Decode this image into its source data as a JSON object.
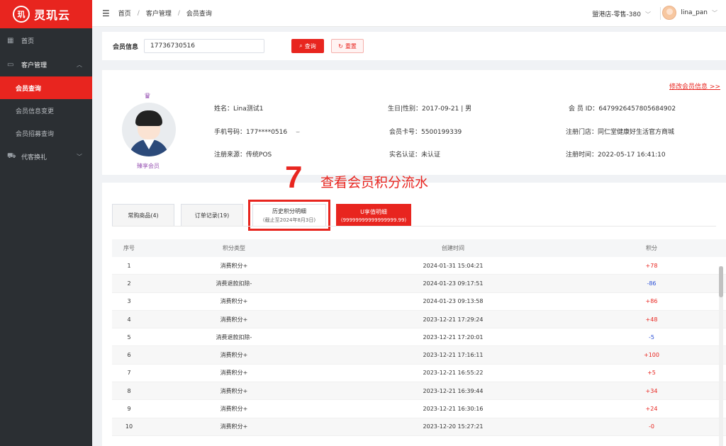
{
  "app": {
    "name": "灵玑云",
    "logo_mark": "玑"
  },
  "sidebar": {
    "items": [
      {
        "icon": "grid-icon",
        "label": "首页"
      },
      {
        "icon": "box-icon",
        "label": "客户管理",
        "expanded": true,
        "children": [
          {
            "label": "会员查询",
            "active": true
          },
          {
            "label": "会员信息变更"
          },
          {
            "label": "会员招募查询"
          }
        ]
      },
      {
        "icon": "cart-icon",
        "label": "代客换礼"
      }
    ]
  },
  "header": {
    "breadcrumb": [
      "首页",
      "客户管理",
      "会员查询"
    ],
    "store": "盟港店-零售-380",
    "username": "lina_pan"
  },
  "search": {
    "label": "会员信息",
    "value": "17736730516",
    "query_label": "查询",
    "reset_label": "重置"
  },
  "member": {
    "edit_link": "修改会员信息 >>",
    "level": "臻享会员",
    "name_label": "姓名：",
    "name": "Lina测试1",
    "birthday_label": "生日|性别：",
    "birthday": "2017-09-21 | 男",
    "id_label": "会 员 ID：",
    "id": "6479926457805684902",
    "phone_label": "手机号码：",
    "phone": "177****0516",
    "card_label": "会员卡号：",
    "card": "5500199339",
    "store_label": "注册门店：",
    "store": "同仁堂健康好生活官方商城",
    "source_label": "注册来源：",
    "source": "传统POS",
    "auth_label": "实名认证：",
    "auth": "未认证",
    "regtime_label": "注册时间：",
    "regtime": "2022-05-17 16:41:10"
  },
  "annotation": {
    "number": "7",
    "text": "查看会员积分流水"
  },
  "tabs": [
    {
      "label": "常购商品(4)",
      "sub": ""
    },
    {
      "label": "订单记录(19)",
      "sub": ""
    },
    {
      "label": "历史积分明细",
      "sub": "(截止至2024年8月3日)"
    },
    {
      "label": "U享值明细",
      "sub": "(99999999999999999.99)"
    }
  ],
  "table": {
    "headers": [
      "序号",
      "积分类型",
      "创建时间",
      "积分"
    ],
    "rows": [
      {
        "no": "1",
        "type": "消费积分+",
        "time": "2024-01-31 15:04:21",
        "points": "+78"
      },
      {
        "no": "2",
        "type": "消费退款扣除-",
        "time": "2024-01-23 09:17:51",
        "points": "-86"
      },
      {
        "no": "3",
        "type": "消费积分+",
        "time": "2024-01-23 09:13:58",
        "points": "+86"
      },
      {
        "no": "4",
        "type": "消费积分+",
        "time": "2023-12-21 17:29:24",
        "points": "+48"
      },
      {
        "no": "5",
        "type": "消费退款扣除-",
        "time": "2023-12-21 17:20:01",
        "points": "-5"
      },
      {
        "no": "6",
        "type": "消费积分+",
        "time": "2023-12-21 17:16:11",
        "points": "+100"
      },
      {
        "no": "7",
        "type": "消费积分+",
        "time": "2023-12-21 16:55:22",
        "points": "+5"
      },
      {
        "no": "8",
        "type": "消费积分+",
        "time": "2023-12-21 16:39:44",
        "points": "+34"
      },
      {
        "no": "9",
        "type": "消费积分+",
        "time": "2023-12-21 16:30:16",
        "points": "+24"
      },
      {
        "no": "10",
        "type": "消费积分+",
        "time": "2023-12-20 15:27:21",
        "points": "-0"
      }
    ]
  },
  "colors": {
    "brand": "#e8251f",
    "sidebar": "#2b2f33",
    "negative": "#2a4fd6",
    "vip": "#9b59b6"
  }
}
